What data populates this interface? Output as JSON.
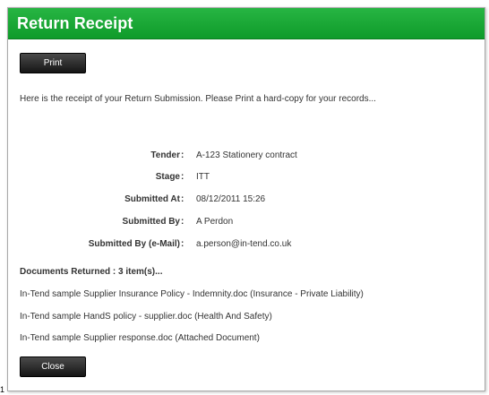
{
  "window": {
    "title": "Return Receipt"
  },
  "buttons": {
    "print_label": "Print",
    "close_label": "Close"
  },
  "intro_text": "Here is the receipt of your Return Submission. Please Print a hard-copy for your records...",
  "fields": [
    {
      "label": "Tender",
      "value": "A-123 Stationery contract"
    },
    {
      "label": "Stage",
      "value": "ITT"
    },
    {
      "label": "Submitted At",
      "value": "08/12/2011 15:26"
    },
    {
      "label": "Submitted By",
      "value": "A Perdon"
    },
    {
      "label": "Submitted By (e-Mail)",
      "value": "a.person@in-tend.co.uk"
    }
  ],
  "separator": ":",
  "documents": {
    "header": "Documents Returned : 3 item(s)...",
    "items": [
      "In-Tend sample Supplier Insurance Policy - Indemnity.doc (Insurance - Private Liability)",
      "In-Tend sample HandS policy - supplier.doc (Health And Safety)",
      "In-Tend sample Supplier response.doc (Attached Document)"
    ]
  },
  "corner_mark": "1",
  "colors": {
    "titlebar_green": "#15a532",
    "button_dark": "#2a2a2a"
  }
}
